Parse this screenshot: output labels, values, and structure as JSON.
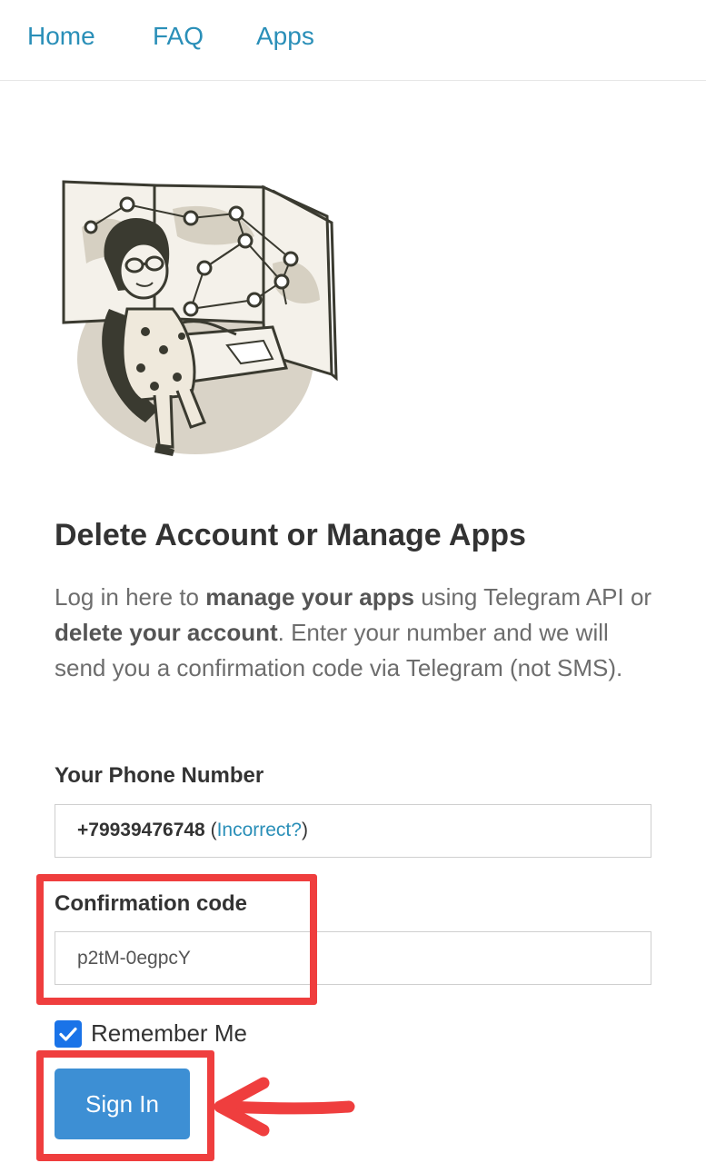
{
  "nav": {
    "home": "Home",
    "faq": "FAQ",
    "apps": "Apps"
  },
  "title": "Delete Account or Manage Apps",
  "description": {
    "part1": "Log in here to ",
    "bold1": "manage your apps",
    "part2": " using Telegram API or ",
    "bold2": "delete your account",
    "part3": ". Enter your number and we will send you a confirmation code via Telegram (not SMS)."
  },
  "phone": {
    "label": "Your Phone Number",
    "number": "+79939476748",
    "open_paren": " (",
    "incorrect": "Incorrect?",
    "close_paren": ")"
  },
  "code": {
    "label": "Confirmation code",
    "value": "p2tM-0egpcY"
  },
  "remember": {
    "label": "Remember Me",
    "checked": true
  },
  "signin": {
    "label": "Sign In"
  },
  "colors": {
    "link": "#2a8fb8",
    "button": "#3d8fd4",
    "checkbox": "#1a73e8",
    "annotation": "#ef3e3e"
  },
  "icons": {
    "illustration": "telegram-woman-at-world-map-illustration",
    "checkbox": "checkmark-icon",
    "arrow": "left-arrow-annotation"
  }
}
